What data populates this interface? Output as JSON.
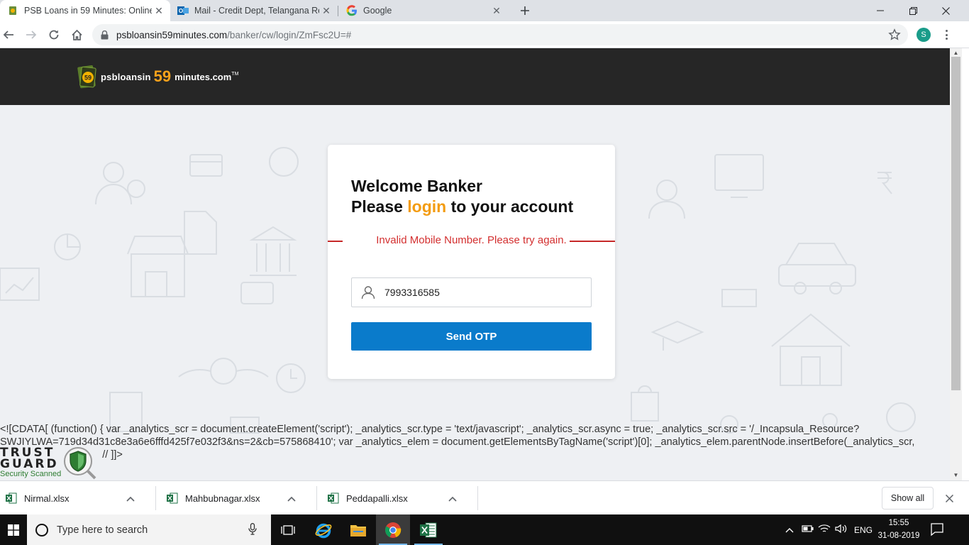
{
  "browser": {
    "tabs": [
      {
        "title": "PSB Loans in 59 Minutes: Online",
        "active": true
      },
      {
        "title": "Mail - Credit Dept, Telangana Re",
        "active": false
      },
      {
        "title": "Google",
        "active": false
      }
    ],
    "url_host": "psbloansin59minutes.com",
    "url_path": "/banker/cw/login/ZmFsc2U=#",
    "profile_initial": "S"
  },
  "site": {
    "logo_badge": "59",
    "logo_text_1": "psbloansin",
    "logo_text_2": "59",
    "logo_text_3": "minutes.com",
    "logo_tm": "TM"
  },
  "login": {
    "heading_line1": "Welcome Banker",
    "heading_prefix": "Please ",
    "heading_highlight": "login",
    "heading_suffix": " to your account",
    "error": "Invalid Mobile Number. Please try again.",
    "mobile_value": "7993316585",
    "send_otp_label": "Send OTP"
  },
  "page_script_text": [
    "<![CDATA[ (function() { var _analytics_scr = document.createElement('script'); _analytics_scr.type = 'text/javascript'; _analytics_scr.async = true; _analytics_scr.src = '/_Incapsula_Resource?",
    "SWJIYLWA=719d34d31c8e3a6e6fffd425f7e032f3&ns=2&cb=575868410'; var _analytics_elem = document.getElementsByTagName('script')[0]; _analytics_elem.parentNode.insertBefore(_analytics_scr,",
    "_analytics_elem); })(); // ]]>"
  ],
  "trust_guard": {
    "line1": "TRUST",
    "line2": "GUARD",
    "line3": "Security Scanned"
  },
  "downloads": {
    "items": [
      {
        "name": "Nirmal.xlsx"
      },
      {
        "name": "Mahbubnagar.xlsx"
      },
      {
        "name": "Peddapalli.xlsx"
      }
    ],
    "show_all": "Show all"
  },
  "taskbar": {
    "search_placeholder": "Type here to search",
    "language": "ENG",
    "time": "15:55",
    "date": "31-08-2019"
  },
  "colors": {
    "accent_orange": "#f39c12",
    "error_red": "#d32f2f",
    "button_blue": "#0a7bcb",
    "header_dark": "#262626"
  }
}
